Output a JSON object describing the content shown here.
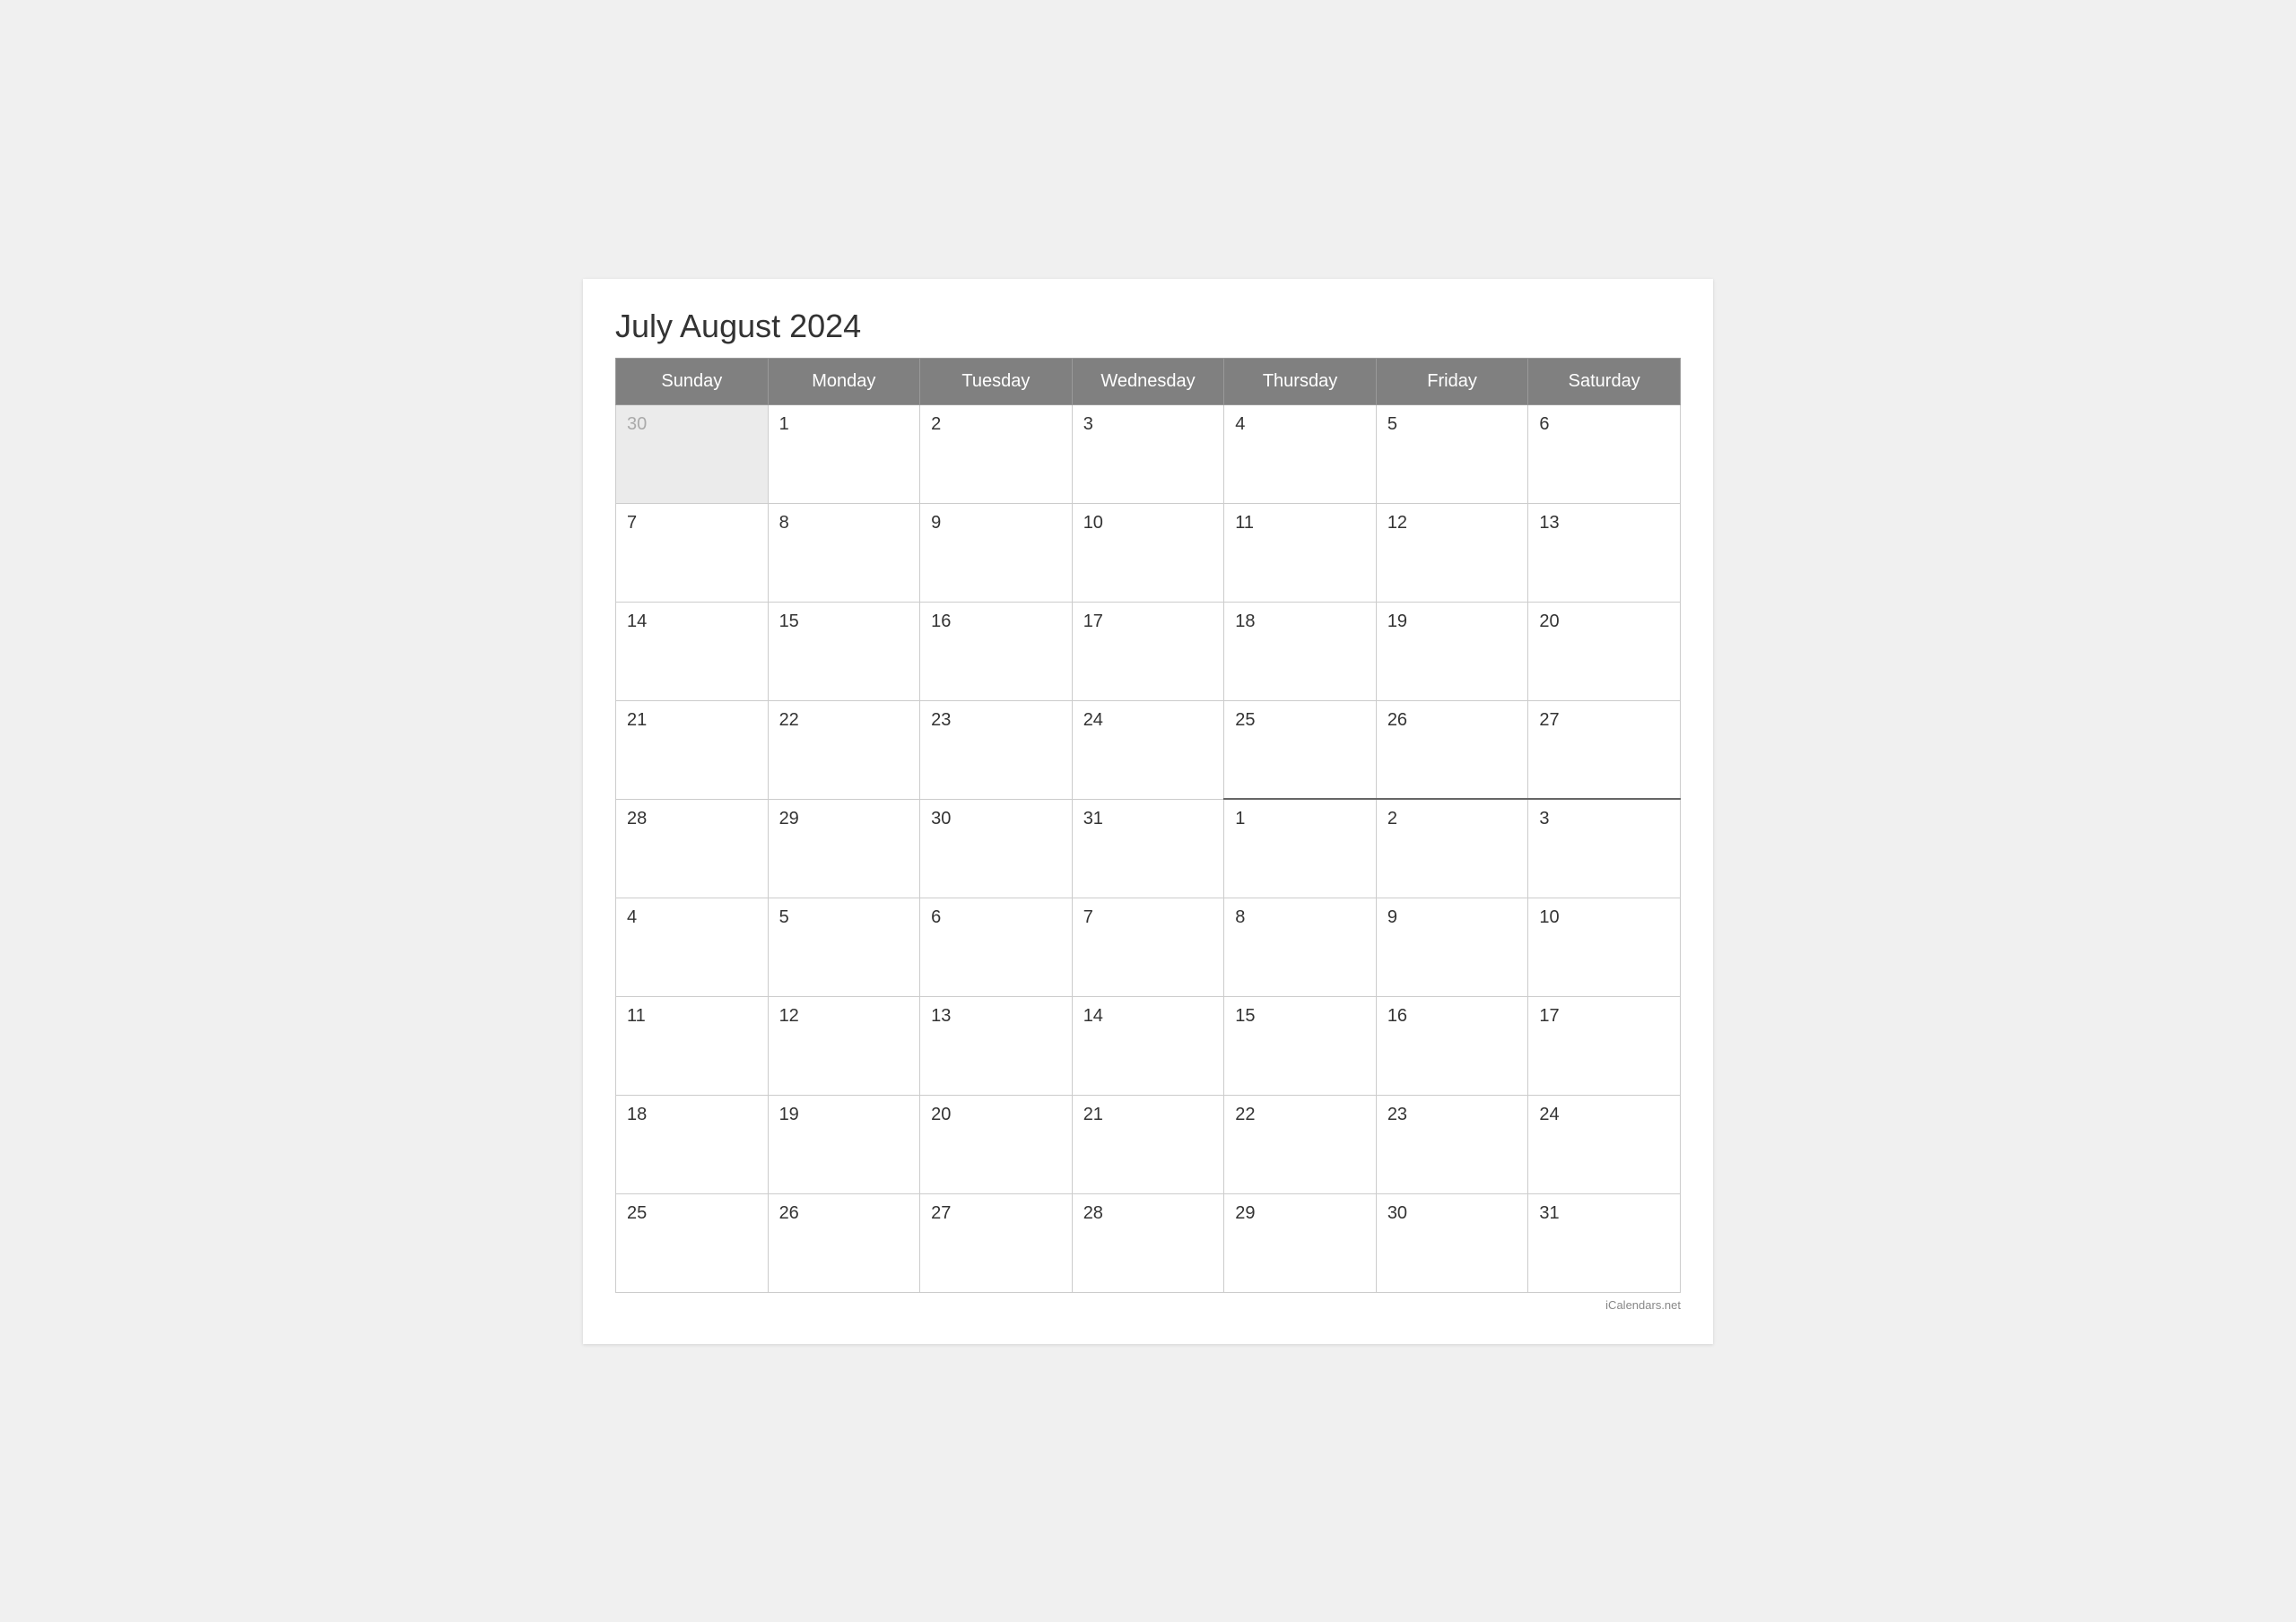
{
  "title": "July August 2024",
  "watermark": "iCalendars.net",
  "headers": [
    "Sunday",
    "Monday",
    "Tuesday",
    "Wednesday",
    "Thursday",
    "Friday",
    "Saturday"
  ],
  "weeks": [
    {
      "cells": [
        {
          "day": "30",
          "type": "other-month"
        },
        {
          "day": "1",
          "type": "current"
        },
        {
          "day": "2",
          "type": "current"
        },
        {
          "day": "3",
          "type": "current"
        },
        {
          "day": "4",
          "type": "current"
        },
        {
          "day": "5",
          "type": "current"
        },
        {
          "day": "6",
          "type": "current"
        }
      ]
    },
    {
      "cells": [
        {
          "day": "7",
          "type": "current"
        },
        {
          "day": "8",
          "type": "current"
        },
        {
          "day": "9",
          "type": "current"
        },
        {
          "day": "10",
          "type": "current"
        },
        {
          "day": "11",
          "type": "current"
        },
        {
          "day": "12",
          "type": "current"
        },
        {
          "day": "13",
          "type": "current"
        }
      ]
    },
    {
      "cells": [
        {
          "day": "14",
          "type": "current"
        },
        {
          "day": "15",
          "type": "current"
        },
        {
          "day": "16",
          "type": "current"
        },
        {
          "day": "17",
          "type": "current"
        },
        {
          "day": "18",
          "type": "current"
        },
        {
          "day": "19",
          "type": "current"
        },
        {
          "day": "20",
          "type": "current"
        }
      ]
    },
    {
      "cells": [
        {
          "day": "21",
          "type": "current"
        },
        {
          "day": "22",
          "type": "current"
        },
        {
          "day": "23",
          "type": "current"
        },
        {
          "day": "24",
          "type": "current"
        },
        {
          "day": "25",
          "type": "current"
        },
        {
          "day": "26",
          "type": "current"
        },
        {
          "day": "27",
          "type": "current"
        }
      ]
    },
    {
      "divider": true,
      "cells": [
        {
          "day": "28",
          "type": "current"
        },
        {
          "day": "29",
          "type": "current"
        },
        {
          "day": "30",
          "type": "current"
        },
        {
          "day": "31",
          "type": "current"
        },
        {
          "day": "1",
          "type": "next-month",
          "divider-start": true
        },
        {
          "day": "2",
          "type": "next-month"
        },
        {
          "day": "3",
          "type": "next-month"
        }
      ]
    },
    {
      "cells": [
        {
          "day": "4",
          "type": "next-month"
        },
        {
          "day": "5",
          "type": "next-month"
        },
        {
          "day": "6",
          "type": "next-month"
        },
        {
          "day": "7",
          "type": "next-month"
        },
        {
          "day": "8",
          "type": "next-month"
        },
        {
          "day": "9",
          "type": "next-month"
        },
        {
          "day": "10",
          "type": "next-month"
        }
      ]
    },
    {
      "cells": [
        {
          "day": "11",
          "type": "next-month"
        },
        {
          "day": "12",
          "type": "next-month"
        },
        {
          "day": "13",
          "type": "next-month"
        },
        {
          "day": "14",
          "type": "next-month"
        },
        {
          "day": "15",
          "type": "next-month"
        },
        {
          "day": "16",
          "type": "next-month"
        },
        {
          "day": "17",
          "type": "next-month"
        }
      ]
    },
    {
      "cells": [
        {
          "day": "18",
          "type": "next-month"
        },
        {
          "day": "19",
          "type": "next-month"
        },
        {
          "day": "20",
          "type": "next-month"
        },
        {
          "day": "21",
          "type": "next-month"
        },
        {
          "day": "22",
          "type": "next-month"
        },
        {
          "day": "23",
          "type": "next-month"
        },
        {
          "day": "24",
          "type": "next-month"
        }
      ]
    },
    {
      "cells": [
        {
          "day": "25",
          "type": "next-month"
        },
        {
          "day": "26",
          "type": "next-month"
        },
        {
          "day": "27",
          "type": "next-month"
        },
        {
          "day": "28",
          "type": "next-month"
        },
        {
          "day": "29",
          "type": "next-month"
        },
        {
          "day": "30",
          "type": "next-month"
        },
        {
          "day": "31",
          "type": "next-month"
        }
      ]
    }
  ]
}
